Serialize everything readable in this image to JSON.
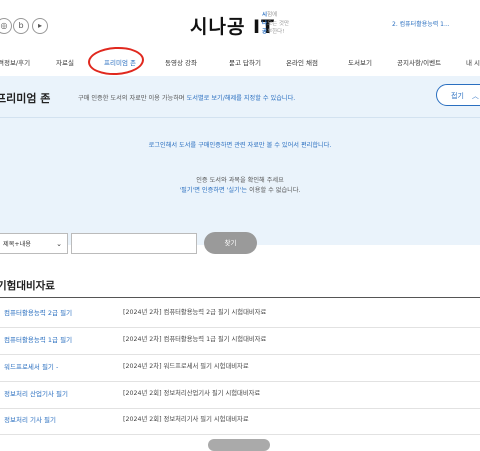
{
  "header": {
    "social_icons": [
      {
        "name": "instagram-icon",
        "glyph": "◎"
      },
      {
        "name": "blog-icon",
        "glyph": "b"
      },
      {
        "name": "youtube-icon",
        "glyph": "▸"
      }
    ],
    "logo_title": "시나공 IT",
    "logo_sub": [
      "시험에",
      "나오는 것만",
      "공부한다!"
    ],
    "logo_sub_initials": [
      "시",
      "나",
      "공"
    ],
    "logo_sub_rest": [
      "험에",
      "오는 것만",
      "부한다!"
    ],
    "selected_exam": "2. 컴퓨터활용능력 1..."
  },
  "nav": {
    "items": [
      "합격정보/후기",
      "자료실",
      "프리미엄 존",
      "동영상 강좌",
      "묻고 답하기",
      "온라인 채점",
      "도서보기",
      "공지사항/이벤트",
      "내 시"
    ],
    "active": "프리미엄 존"
  },
  "premium": {
    "title": "프리미엄 존",
    "desc_prefix": "구매 인증한 도서의 자료만 이용 가능하며 ",
    "desc_highlight": "도서별로 보기/해제를 지정할 수 있습니다.",
    "fold_label": "접기",
    "login_msg": "로그인해서 도서를 구매인증하면 관련 자료만 볼 수 있어서 편리합니다.",
    "confirm_msg": "인증 도서와 과목을 확인해 주세요",
    "hint_highlight": "'필기'면 인증하면 '실기'는",
    "hint_rest": " 이용할 수 없습니다."
  },
  "search": {
    "select_value": "제목+내용",
    "input_placeholder": "",
    "button_label": "찾기"
  },
  "list": {
    "title": "기험대비자료",
    "rows": [
      {
        "category": "컴퓨터활용능력 2급 필기",
        "title": "[2024년 2차] 컴퓨터활용능력 2급 필기 시험대비자료"
      },
      {
        "category": "컴퓨터활용능력 1급 필기",
        "title": "[2024년 2차] 컴퓨터활용능력 1급 필기 시험대비자료"
      },
      {
        "category": "워드프로세서 필기 -",
        "title": "[2024년 2차] 워드프로세서 필기 시험대비자료"
      },
      {
        "category": "정보처리 산업기사 필기",
        "title": "[2024년 2회] 정보처리산업기사 필기 시험대비자료"
      },
      {
        "category": "정보처리 기사 필기",
        "title": "[2024년 2회] 정보처리기사 필기 시험대비자료"
      }
    ]
  },
  "colors": {
    "accent": "#2a6fc0",
    "highlight_circle": "#e0281e",
    "premium_bg": "#eaf3fb"
  }
}
